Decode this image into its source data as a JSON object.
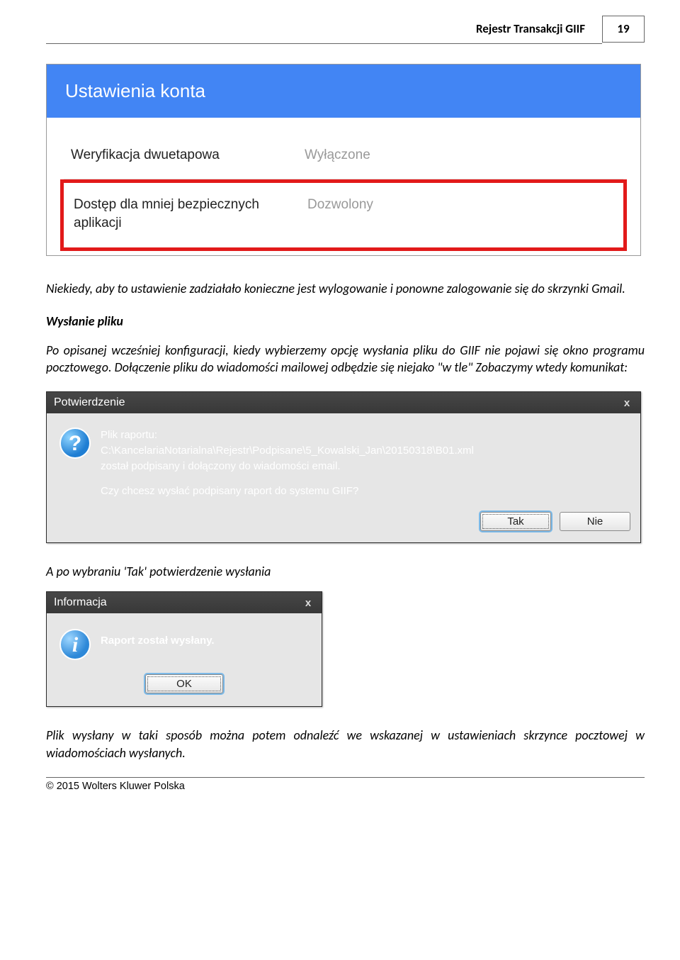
{
  "header": {
    "title": "Rejestr Transakcji GIIF",
    "page_number": "19"
  },
  "account_settings": {
    "banner": "Ustawienia konta",
    "row1_label": "Weryfikacja dwuetapowa",
    "row1_value": "Wyłączone",
    "row2_label": "Dostęp dla mniej bezpiecznych aplikacji",
    "row2_value": "Dozwolony"
  },
  "paragraph1": "Niekiedy, aby to ustawienie zadziałało konieczne jest wylogowanie i ponowne zalogowanie się do skrzynki Gmail.",
  "section_heading": "Wysłanie pliku",
  "paragraph2": "Po opisanej wcześniej konfiguracji, kiedy wybierzemy opcję wysłania pliku do GIIF nie pojawi się okno programu pocztowego. Dołączenie pliku do wiadomości mailowej odbędzie się niejako \"w tle\" Zobaczymy wtedy komunikat:",
  "dialog1": {
    "title": "Potwierdzenie",
    "msg_line1": "Plik raportu:",
    "msg_line2": "C:\\KancelariaNotarialna\\Rejestr\\Podpisane\\5_Kowalski_Jan\\20150318\\B01.xml",
    "msg_line3": "został podpisany i dołączony do wiadomości email.",
    "msg_line4": "Czy chcesz wysłać podpisany raport do systemu GIIF?",
    "btn_yes": "Tak",
    "btn_no": "Nie"
  },
  "paragraph3": "A po wybraniu 'Tak' potwierdzenie wysłania",
  "dialog2": {
    "title": "Informacja",
    "msg": "Raport został wysłany.",
    "btn_ok": "OK"
  },
  "paragraph4": "Plik wysłany w taki sposób można potem odnaleźć we wskazanej w ustawieniach skrzynce pocztowej w wiadomościach wysłanych.",
  "footer": "© 2015 Wolters Kluwer Polska"
}
